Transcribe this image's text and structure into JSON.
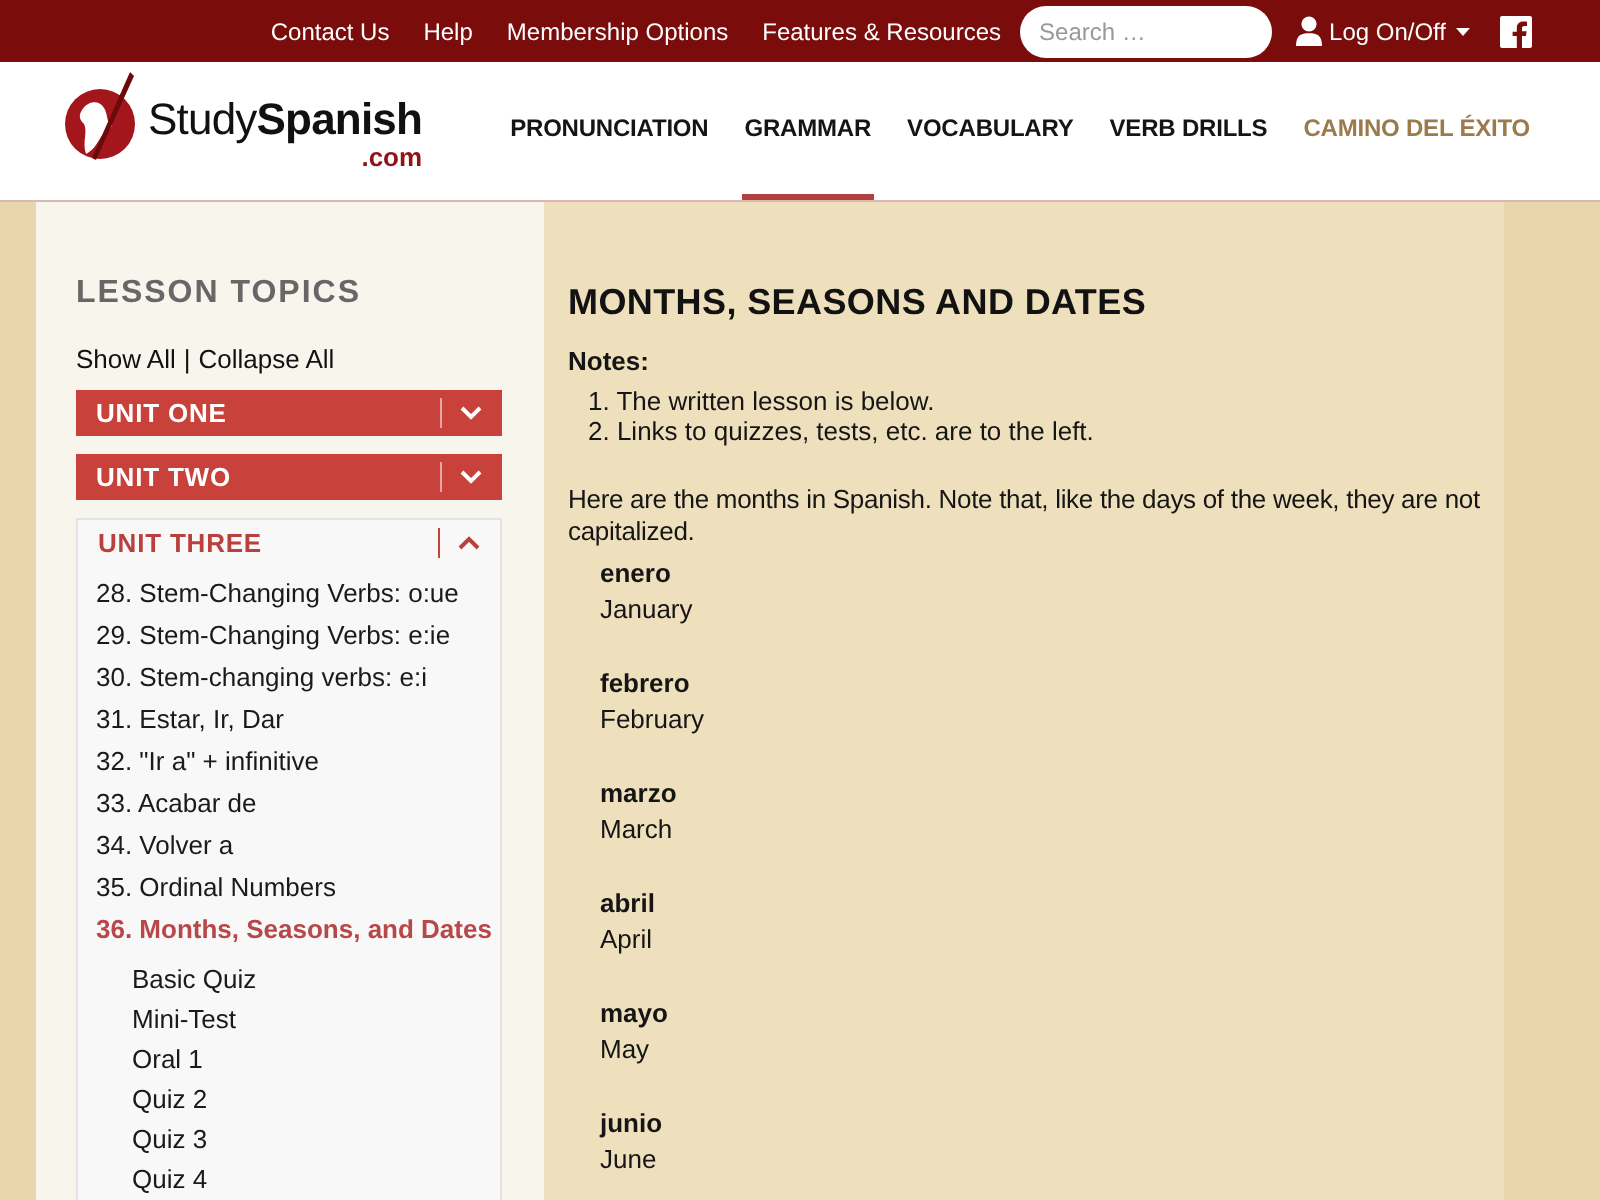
{
  "top_bar": {
    "links": [
      "Contact Us",
      "Help",
      "Membership Options",
      "Features & Resources"
    ],
    "search": {
      "placeholder": "Search …"
    },
    "account_menu": "Log On/Off"
  },
  "header": {
    "logo": {
      "wordmark": "Study**Spanish**",
      "domain": ".com"
    },
    "nav": [
      {
        "label": "PRONUNCIATION",
        "selected": false,
        "kind": "standard"
      },
      {
        "label": "GRAMMAR",
        "selected": true,
        "kind": "standard"
      },
      {
        "label": "VOCABULARY",
        "selected": false,
        "kind": "standard"
      },
      {
        "label": "VERB DRILLS",
        "selected": false,
        "kind": "standard"
      },
      {
        "label": "CAMINO DEL ÉXITO",
        "selected": false,
        "kind": "featured"
      }
    ]
  },
  "sidebar": {
    "title": "LESSON TOPICS",
    "show_all": "Show All",
    "separator": "|",
    "collapse_all": "Collapse All",
    "units": [
      {
        "title": "UNIT ONE",
        "expanded": false
      },
      {
        "title": "UNIT TWO",
        "expanded": false
      },
      {
        "title": "UNIT THREE",
        "expanded": true,
        "lessons": [
          {
            "label": "28. Stem-Changing Verbs: o:ue",
            "selected": false
          },
          {
            "label": "29. Stem-Changing Verbs: e:ie",
            "selected": false
          },
          {
            "label": "30. Stem-changing verbs: e:i",
            "selected": false
          },
          {
            "label": "31. Estar, Ir, Dar",
            "selected": false
          },
          {
            "label": "32. \"Ir a\" + infinitive",
            "selected": false
          },
          {
            "label": "33. Acabar de",
            "selected": false
          },
          {
            "label": "34. Volver a",
            "selected": false
          },
          {
            "label": "35. Ordinal Numbers",
            "selected": false
          },
          {
            "label": "36. Months, Seasons, and Dates",
            "selected": true,
            "children": [
              {
                "label": "Basic Quiz"
              },
              {
                "label": "Mini-Test"
              },
              {
                "label": "Oral 1"
              },
              {
                "label": "Quiz 2"
              },
              {
                "label": "Quiz 3"
              },
              {
                "label": "Quiz 4"
              }
            ]
          }
        ]
      }
    ]
  },
  "main": {
    "title": "MONTHS, SEASONS AND DATES",
    "notes_heading": "Notes:",
    "notes": [
      "1. The written lesson is below.",
      "2. Links to quizzes, tests, etc. are to the left."
    ],
    "intro": "Here are the months in Spanish. Note that, like the days of the week, they are not capitalized.",
    "months": [
      {
        "spanish": "enero",
        "english": "January"
      },
      {
        "spanish": "febrero",
        "english": "February"
      },
      {
        "spanish": "marzo",
        "english": "March"
      },
      {
        "spanish": "abril",
        "english": "April"
      },
      {
        "spanish": "mayo",
        "english": "May"
      },
      {
        "spanish": "junio",
        "english": "June"
      }
    ]
  }
}
